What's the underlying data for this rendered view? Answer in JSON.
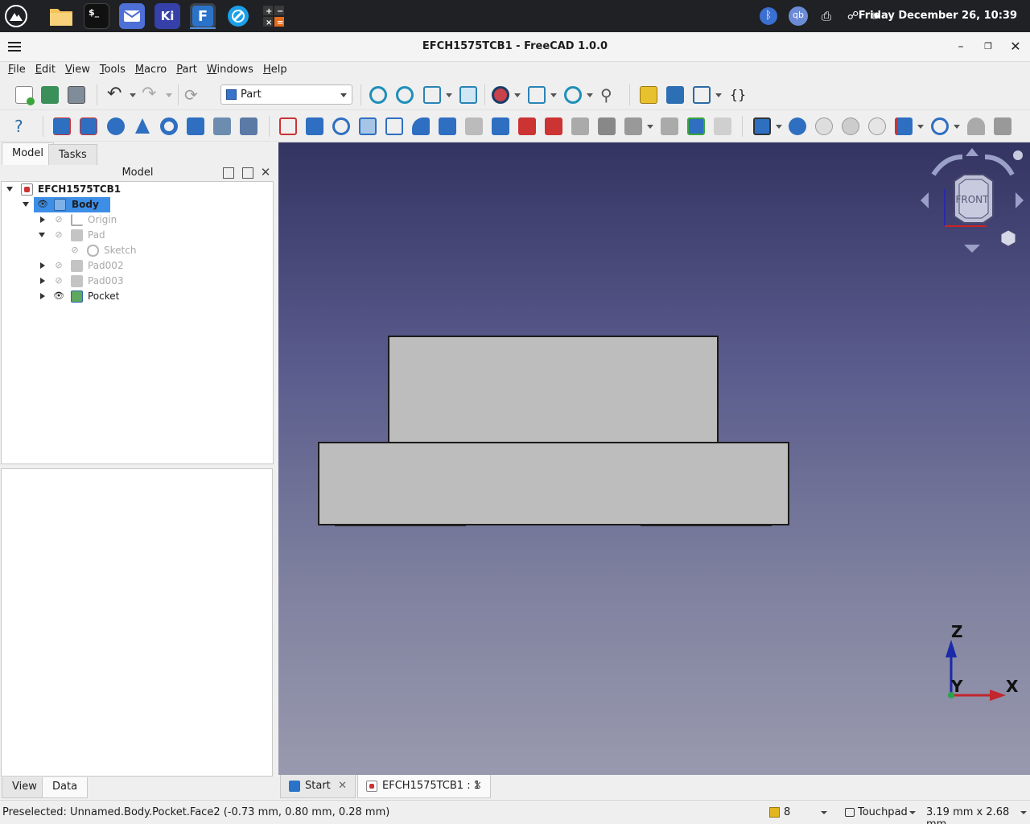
{
  "taskbar": {
    "apps": [
      {
        "name": "files",
        "icon": "folder-icon"
      },
      {
        "name": "terminal",
        "icon": "terminal-icon",
        "glyph": "$_"
      },
      {
        "name": "mail",
        "icon": "mail-icon"
      },
      {
        "name": "kicad",
        "icon": "kicad-icon",
        "glyph": "Ki"
      },
      {
        "name": "freecad",
        "icon": "freecad-icon",
        "glyph": "F"
      },
      {
        "name": "browser",
        "icon": "browser-icon"
      },
      {
        "name": "calculator",
        "icon": "calculator-icon"
      }
    ],
    "clock": "Friday December 26, 10:39",
    "tray_qb": "qb"
  },
  "window": {
    "title": "EFCH1575TCB1 - FreeCAD 1.0.0"
  },
  "menu": {
    "items": [
      {
        "u": "F",
        "rest": "ile"
      },
      {
        "u": "E",
        "rest": "dit"
      },
      {
        "u": "V",
        "rest": "iew"
      },
      {
        "u": "T",
        "rest": "ools"
      },
      {
        "u": "M",
        "rest": "acro"
      },
      {
        "u": "P",
        "rest": "art"
      },
      {
        "u": "W",
        "rest": "indows"
      },
      {
        "u": "H",
        "rest": "elp"
      }
    ]
  },
  "toolbar": {
    "workbench": "Part",
    "macro_glyph": "{}"
  },
  "left_panel": {
    "tabs": [
      "Model",
      "Tasks"
    ],
    "header": "Model",
    "tree": {
      "doc": "EFCH1575TCB1",
      "items": [
        {
          "label": "Body"
        },
        {
          "label": "Origin"
        },
        {
          "label": "Pad"
        },
        {
          "label": "Sketch"
        },
        {
          "label": "Pad002"
        },
        {
          "label": "Pad003"
        },
        {
          "label": "Pocket"
        }
      ]
    },
    "bottom_tabs": [
      "View",
      "Data"
    ]
  },
  "view3d": {
    "navcube_face": "FRONT",
    "axis_z": "Z",
    "axis_y": "Y",
    "axis_x": "X"
  },
  "doc_tabs": [
    {
      "label": "Start"
    },
    {
      "label": "EFCH1575TCB1 : 1"
    }
  ],
  "status": {
    "text": "Preselected: Unnamed.Body.Pocket.Face2 (-0.73 mm, 0.80 mm, 0.28 mm)",
    "count": "8",
    "nav_style": "Touchpad",
    "dimensions": "3.19 mm x 2.68 mm"
  }
}
